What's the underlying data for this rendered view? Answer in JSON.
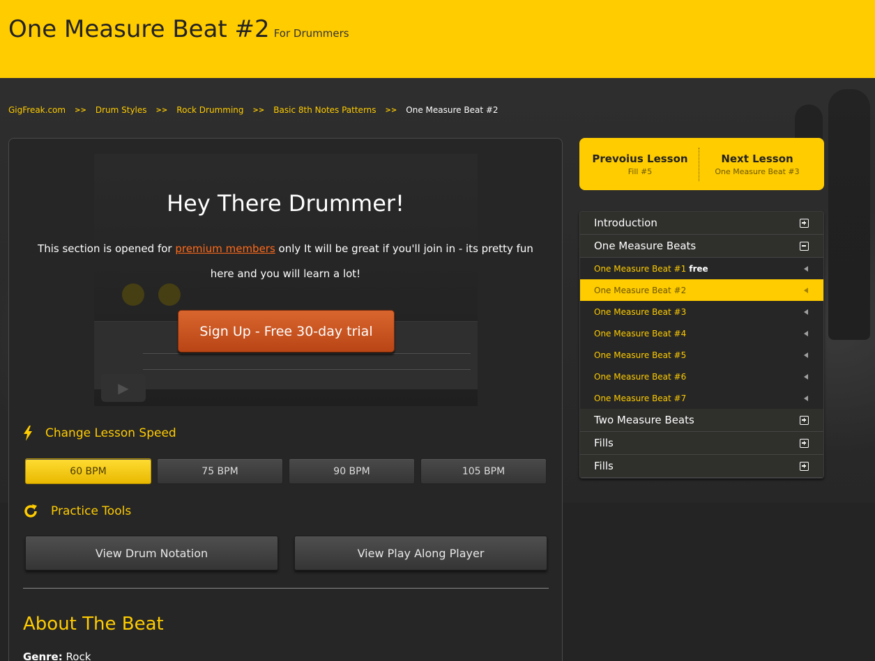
{
  "header": {
    "title": "One Measure Beat #2",
    "subtitle": "For Drummers",
    "background_color": "#ffcc00"
  },
  "breadcrumb": {
    "separator": ">>",
    "items": [
      "GigFreak.com",
      "Drum Styles",
      "Rock Drumming",
      "Basic 8th Notes Patterns"
    ],
    "current": "One Measure Beat #2"
  },
  "hero": {
    "title": "Hey There Drummer!",
    "text_before": "This section is opened for ",
    "link": "premium members",
    "text_after": " only It will be great if you'll join in - its pretty fun here and you will learn a lot!",
    "signup_button": "Sign Up - Free 30-day trial"
  },
  "speed": {
    "heading": "Change Lesson Speed",
    "icon": "lightning-icon",
    "options": [
      "60 BPM",
      "75 BPM",
      "90 BPM",
      "105 BPM"
    ],
    "selected": "60 BPM"
  },
  "tools": {
    "heading": "Practice Tools",
    "icon": "refresh-icon",
    "buttons": [
      "View Drum Notation",
      "View Play Along Player"
    ]
  },
  "about": {
    "title": "About The Beat",
    "genre_label": "Genre:",
    "genre_value": "Rock"
  },
  "lesson_nav": {
    "previous_label": "Prevoius Lesson",
    "previous_name": "Fill #5",
    "next_label": "Next Lesson",
    "next_name": "One Measure Beat #3"
  },
  "menu": {
    "categories": [
      {
        "label": "Introduction",
        "state": "collapsed"
      },
      {
        "label": "One Measure Beats",
        "state": "expanded"
      },
      {
        "label": "Two Measure Beats",
        "state": "collapsed"
      },
      {
        "label": "Fills",
        "state": "collapsed"
      },
      {
        "label": "Fills",
        "state": "collapsed"
      }
    ],
    "lessons": [
      {
        "label": "One Measure Beat #1",
        "badge": "free",
        "active": false
      },
      {
        "label": "One Measure Beat #2",
        "badge": "",
        "active": true
      },
      {
        "label": "One Measure Beat #3",
        "badge": "",
        "active": false
      },
      {
        "label": "One Measure Beat #4",
        "badge": "",
        "active": false
      },
      {
        "label": "One Measure Beat #5",
        "badge": "",
        "active": false
      },
      {
        "label": "One Measure Beat #6",
        "badge": "",
        "active": false
      },
      {
        "label": "One Measure Beat #7",
        "badge": "",
        "active": false
      }
    ]
  },
  "colors": {
    "accent": "#ffcc00",
    "signup": "#c9521f",
    "link": "#ff6a1a",
    "background": "#242424"
  }
}
